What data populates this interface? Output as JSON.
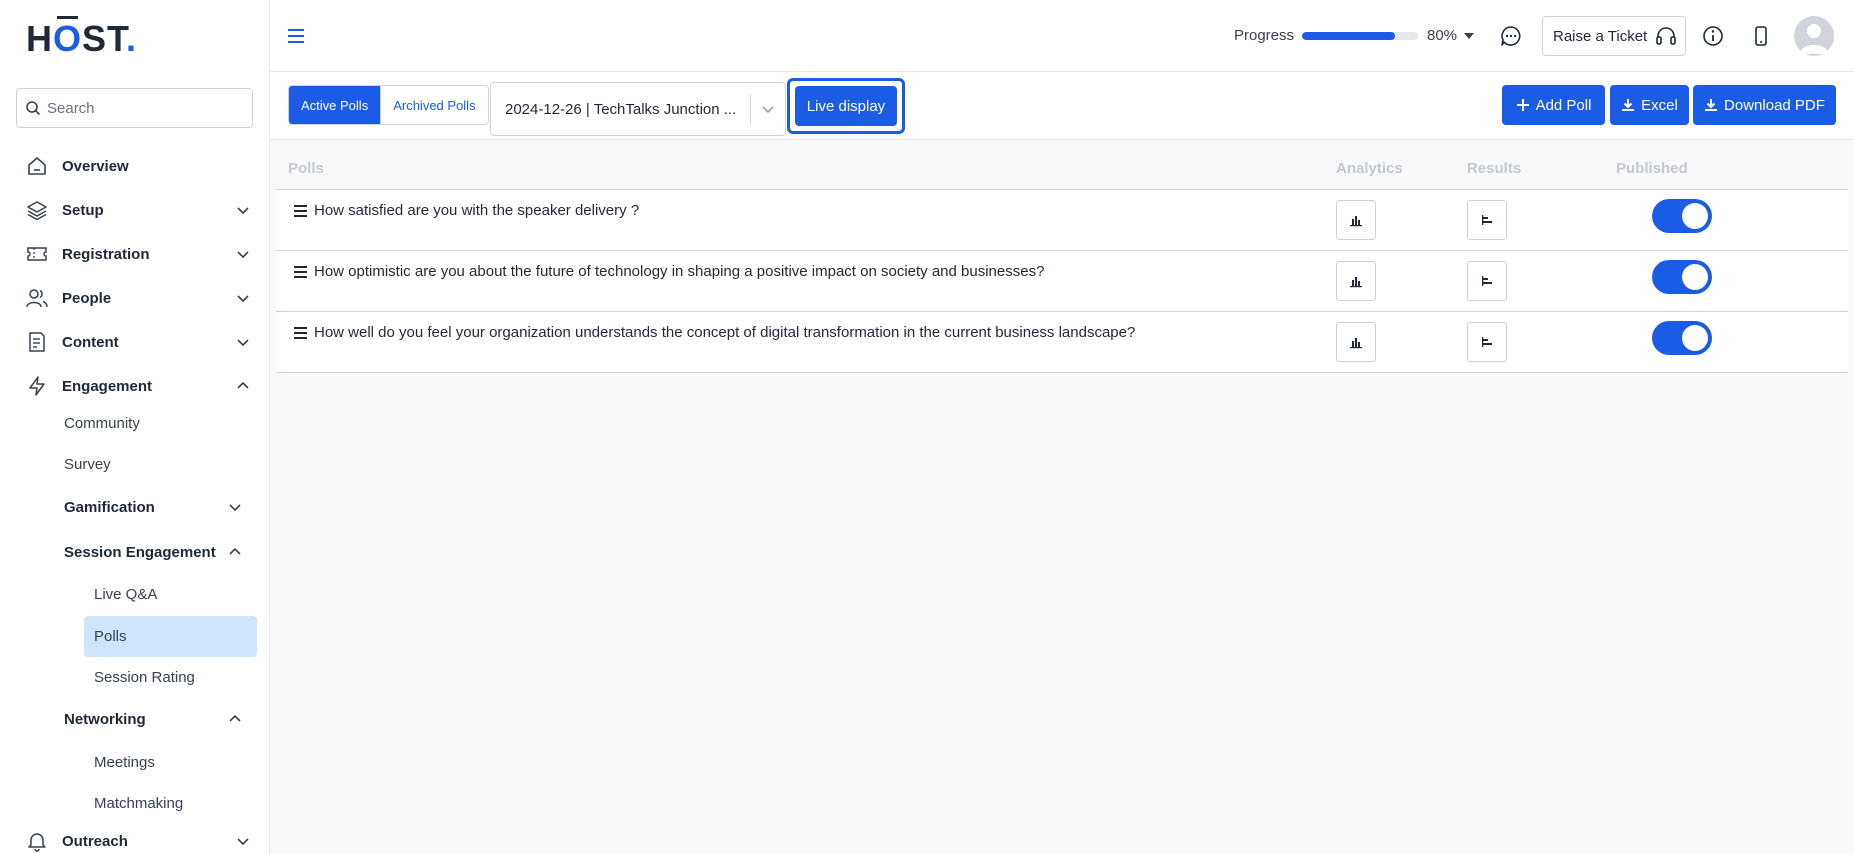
{
  "logo": {
    "part1": "H",
    "part2": "O",
    "part3": "ST",
    "part4": "."
  },
  "search": {
    "placeholder": "Search"
  },
  "sidebar": {
    "items": [
      {
        "label": "Overview",
        "icon": "home-icon"
      },
      {
        "label": "Setup",
        "icon": "layers-icon"
      },
      {
        "label": "Registration",
        "icon": "ticket-icon"
      },
      {
        "label": "People",
        "icon": "users-icon"
      },
      {
        "label": "Content",
        "icon": "document-icon"
      },
      {
        "label": "Engagement",
        "icon": "lightning-icon"
      },
      {
        "label": "Outreach",
        "icon": "bell-icon"
      }
    ],
    "engagement_sub": {
      "community": "Community",
      "survey": "Survey",
      "gamification": "Gamification",
      "session_engagement": "Session Engagement",
      "live_qa": "Live Q&A",
      "polls": "Polls",
      "session_rating": "Session Rating",
      "networking": "Networking",
      "meetings": "Meetings",
      "matchmaking": "Matchmaking"
    }
  },
  "topbar": {
    "progress_label": "Progress",
    "progress_value": 80,
    "progress_text": "80%",
    "ticket_label": "Raise a Ticket"
  },
  "toolbar": {
    "active_polls": "Active Polls",
    "archived_polls": "Archived Polls",
    "session_select": "2024-12-26 | TechTalks Junction ...",
    "live_display": "Live display",
    "add_poll": "Add Poll",
    "excel": "Excel",
    "download_pdf": "Download PDF"
  },
  "table": {
    "headers": {
      "polls": "Polls",
      "analytics": "Analytics",
      "results": "Results",
      "published": "Published"
    },
    "rows": [
      {
        "question": "How satisfied are you with the speaker delivery ?",
        "published": true
      },
      {
        "question": "How optimistic are you about the future of technology in shaping a positive impact on society and businesses?",
        "published": true
      },
      {
        "question": "How well do you feel your organization understands the concept of digital transformation in the current business landscape?",
        "published": true
      }
    ]
  },
  "colors": {
    "accent": "#1a5ce6",
    "active_nav_bg": "#cfe5fb"
  }
}
